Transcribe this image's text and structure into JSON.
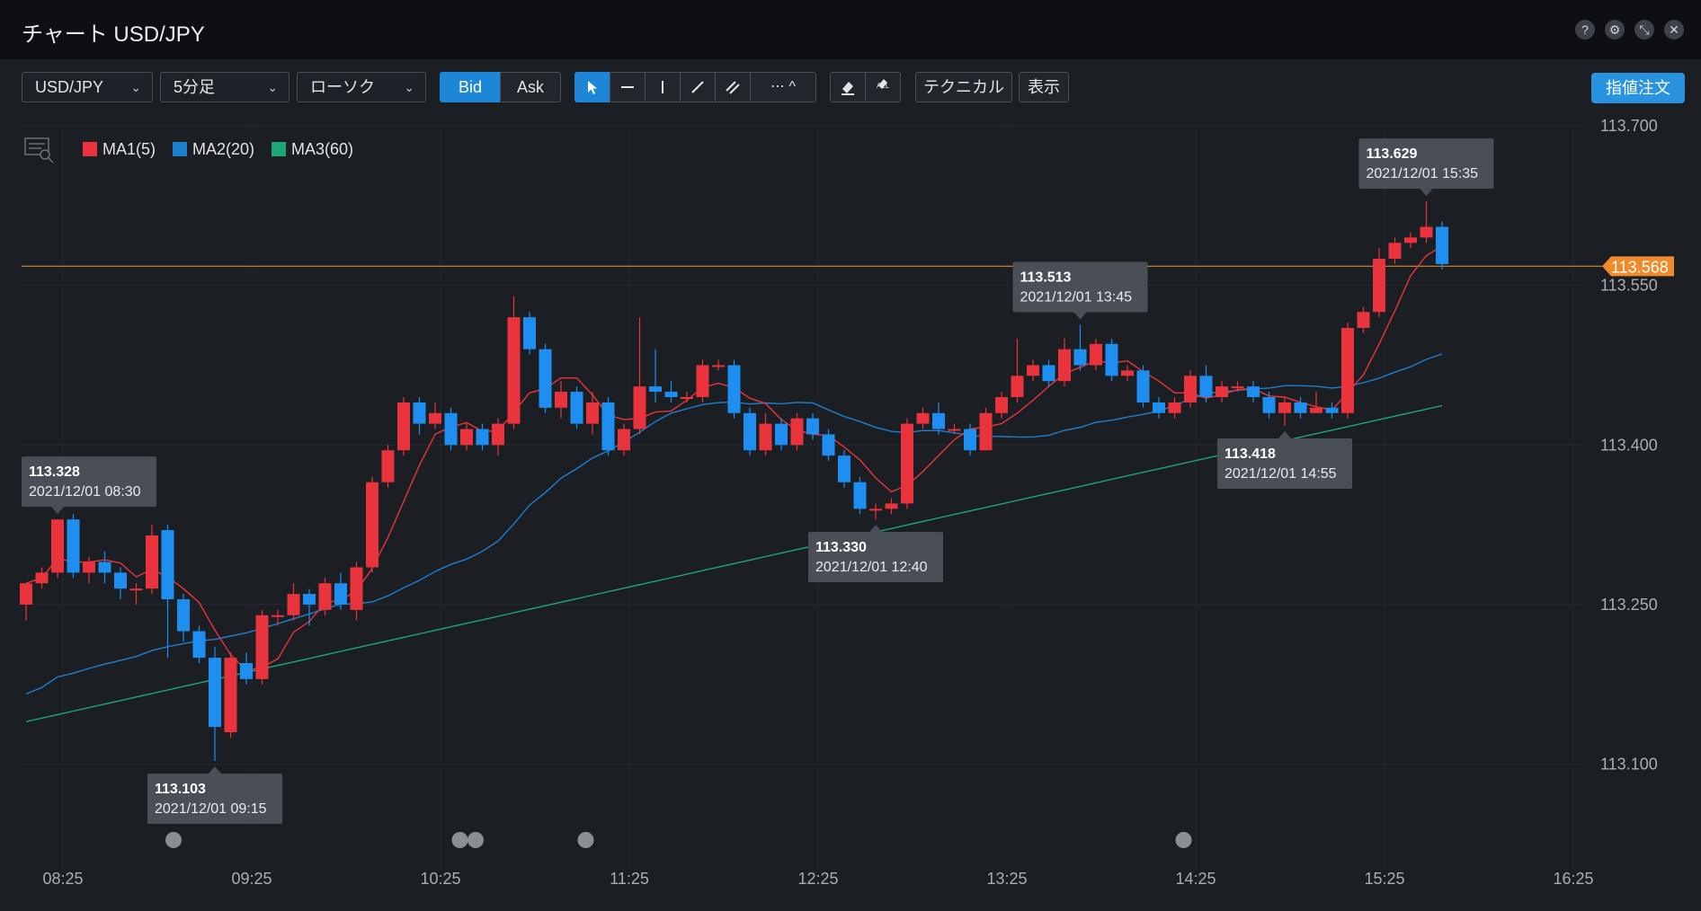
{
  "window": {
    "title": "チャート USD/JPY",
    "buttons": [
      {
        "name": "help-icon",
        "glyph": "?"
      },
      {
        "name": "gear-icon",
        "glyph": "⚙"
      },
      {
        "name": "shrink-icon",
        "glyph": "⤡"
      },
      {
        "name": "close-icon",
        "glyph": "✕"
      }
    ]
  },
  "toolbar": {
    "symbol": "USD/JPY",
    "timeframe": "5分足",
    "chart_style": "ローソク",
    "bid_label": "Bid",
    "ask_label": "Ask",
    "technical_label": "テクニカル",
    "display_label": "表示",
    "order_label": "指値注文",
    "erase_all_label": "ALL",
    "more_glyph": "⋯ ^"
  },
  "colors": {
    "up": "#e9343d",
    "down": "#1e8ff0",
    "ma1": "#e9343d",
    "ma2": "#1f7fcf",
    "ma3": "#1ea67a",
    "price_line": "#d98a2e",
    "price_badge": "#f08a2a"
  },
  "chart_data": {
    "type": "candlestick",
    "symbol": "USD/JPY",
    "x": [
      "08:25",
      "09:25",
      "10:25",
      "11:25",
      "12:25",
      "13:25",
      "14:25",
      "15:25",
      "16:25"
    ],
    "ylim": [
      113.0,
      113.7
    ],
    "y_ticks": [
      "113.700",
      "113.550",
      "113.400",
      "113.250",
      "113.100"
    ],
    "current_price": "113.568",
    "legend": [
      {
        "name": "MA1(5)",
        "color": "#e9343d"
      },
      {
        "name": "MA2(20)",
        "color": "#1f7fcf"
      },
      {
        "name": "MA3(60)",
        "color": "#1ea67a"
      }
    ],
    "candles": [
      [
        113.25,
        113.27,
        113.27,
        113.235
      ],
      [
        113.27,
        113.28,
        113.285,
        113.265
      ],
      [
        113.28,
        113.33,
        113.33,
        113.275
      ],
      [
        113.33,
        113.28,
        113.335,
        113.275
      ],
      [
        113.28,
        113.29,
        113.295,
        113.27
      ],
      [
        113.29,
        113.28,
        113.3,
        113.27
      ],
      [
        113.28,
        113.265,
        113.285,
        113.255
      ],
      [
        113.265,
        113.265,
        113.27,
        113.25
      ],
      [
        113.265,
        113.315,
        113.325,
        113.26
      ],
      [
        113.32,
        113.255,
        113.325,
        113.2
      ],
      [
        113.255,
        113.225,
        113.26,
        113.215
      ],
      [
        113.225,
        113.2,
        113.23,
        113.195
      ],
      [
        113.2,
        113.135,
        113.21,
        113.103
      ],
      [
        113.13,
        113.2,
        113.205,
        113.125
      ],
      [
        113.195,
        113.18,
        113.205,
        113.175
      ],
      [
        113.18,
        113.24,
        113.245,
        113.175
      ],
      [
        113.24,
        113.24,
        113.245,
        113.23
      ],
      [
        113.24,
        113.26,
        113.27,
        113.235
      ],
      [
        113.26,
        113.25,
        113.265,
        113.23
      ],
      [
        113.245,
        113.27,
        113.275,
        113.24
      ],
      [
        113.27,
        113.25,
        113.28,
        113.245
      ],
      [
        113.245,
        113.285,
        113.29,
        113.235
      ],
      [
        113.285,
        113.365,
        113.37,
        113.28
      ],
      [
        113.365,
        113.395,
        113.4,
        113.36
      ],
      [
        113.395,
        113.44,
        113.445,
        113.39
      ],
      [
        113.44,
        113.42,
        113.445,
        113.41
      ],
      [
        113.42,
        113.43,
        113.44,
        113.415
      ],
      [
        113.43,
        113.4,
        113.435,
        113.395
      ],
      [
        113.4,
        113.415,
        113.42,
        113.395
      ],
      [
        113.415,
        113.4,
        113.42,
        113.395
      ],
      [
        113.4,
        113.42,
        113.425,
        113.39
      ],
      [
        113.42,
        113.52,
        113.54,
        113.415
      ],
      [
        113.52,
        113.49,
        113.525,
        113.485
      ],
      [
        113.49,
        113.435,
        113.495,
        113.43
      ],
      [
        113.435,
        113.45,
        113.46,
        113.425
      ],
      [
        113.45,
        113.42,
        113.455,
        113.415
      ],
      [
        113.42,
        113.44,
        113.45,
        113.41
      ],
      [
        113.44,
        113.395,
        113.445,
        113.39
      ],
      [
        113.395,
        113.415,
        113.42,
        113.39
      ],
      [
        113.415,
        113.455,
        113.52,
        113.41
      ],
      [
        113.455,
        113.45,
        113.49,
        113.44
      ],
      [
        113.45,
        113.445,
        113.46,
        113.44
      ],
      [
        113.445,
        113.445,
        113.45,
        113.44
      ],
      [
        113.445,
        113.475,
        113.48,
        113.44
      ],
      [
        113.475,
        113.475,
        113.48,
        113.47
      ],
      [
        113.475,
        113.43,
        113.48,
        113.425
      ],
      [
        113.43,
        113.395,
        113.435,
        113.39
      ],
      [
        113.395,
        113.42,
        113.43,
        113.39
      ],
      [
        113.42,
        113.4,
        113.425,
        113.395
      ],
      [
        113.4,
        113.425,
        113.43,
        113.395
      ],
      [
        113.425,
        113.41,
        113.43,
        113.405
      ],
      [
        113.41,
        113.39,
        113.415,
        113.385
      ],
      [
        113.39,
        113.365,
        113.395,
        113.36
      ],
      [
        113.365,
        113.34,
        113.37,
        113.335
      ],
      [
        113.34,
        113.34,
        113.345,
        113.33
      ],
      [
        113.34,
        113.345,
        113.35,
        113.335
      ],
      [
        113.345,
        113.42,
        113.425,
        113.34
      ],
      [
        113.42,
        113.43,
        113.435,
        113.415
      ],
      [
        113.43,
        113.415,
        113.44,
        113.41
      ],
      [
        113.415,
        113.415,
        113.42,
        113.41
      ],
      [
        113.415,
        113.395,
        113.42,
        113.39
      ],
      [
        113.395,
        113.43,
        113.435,
        113.395
      ],
      [
        113.43,
        113.445,
        113.45,
        113.425
      ],
      [
        113.445,
        113.465,
        113.5,
        113.44
      ],
      [
        113.465,
        113.475,
        113.48,
        113.46
      ],
      [
        113.475,
        113.46,
        113.48,
        113.455
      ],
      [
        113.46,
        113.49,
        113.5,
        113.455
      ],
      [
        113.49,
        113.475,
        113.513,
        113.47
      ],
      [
        113.475,
        113.495,
        113.5,
        113.47
      ],
      [
        113.495,
        113.465,
        113.5,
        113.46
      ],
      [
        113.465,
        113.47,
        113.475,
        113.46
      ],
      [
        113.47,
        113.44,
        113.475,
        113.435
      ],
      [
        113.44,
        113.43,
        113.445,
        113.425
      ],
      [
        113.43,
        113.44,
        113.445,
        113.425
      ],
      [
        113.44,
        113.465,
        113.47,
        113.435
      ],
      [
        113.465,
        113.445,
        113.475,
        113.44
      ],
      [
        113.445,
        113.455,
        113.46,
        113.44
      ],
      [
        113.455,
        113.455,
        113.46,
        113.45
      ],
      [
        113.455,
        113.445,
        113.46,
        113.44
      ],
      [
        113.445,
        113.43,
        113.45,
        113.425
      ],
      [
        113.43,
        113.44,
        113.445,
        113.418
      ],
      [
        113.44,
        113.43,
        113.445,
        113.425
      ],
      [
        113.43,
        113.435,
        113.45,
        113.43
      ],
      [
        113.435,
        113.43,
        113.44,
        113.425
      ],
      [
        113.43,
        113.51,
        113.515,
        113.425
      ],
      [
        113.51,
        113.525,
        113.53,
        113.505
      ],
      [
        113.525,
        113.575,
        113.585,
        113.52
      ],
      [
        113.575,
        113.59,
        113.595,
        113.57
      ],
      [
        113.59,
        113.595,
        113.6,
        113.585
      ],
      [
        113.595,
        113.605,
        113.629,
        113.59
      ],
      [
        113.605,
        113.57,
        113.61,
        113.565
      ]
    ],
    "annotations": [
      {
        "price": "113.629",
        "time": "2021/12/01 15:35",
        "index": 89,
        "place": "above"
      },
      {
        "price": "113.513",
        "time": "2021/12/01 13:45",
        "index": 67,
        "place": "above"
      },
      {
        "price": "113.418",
        "time": "2021/12/01 14:55",
        "index": 80,
        "place": "below"
      },
      {
        "price": "113.330",
        "time": "2021/12/01 12:40",
        "index": 54,
        "place": "below"
      },
      {
        "price": "113.328",
        "time": "2021/12/01 08:30",
        "index": 2,
        "place": "above"
      },
      {
        "price": "113.103",
        "time": "2021/12/01 09:15",
        "index": 12,
        "place": "below"
      }
    ],
    "event_markers": [
      27,
      28,
      35,
      73
    ],
    "grid": true
  }
}
